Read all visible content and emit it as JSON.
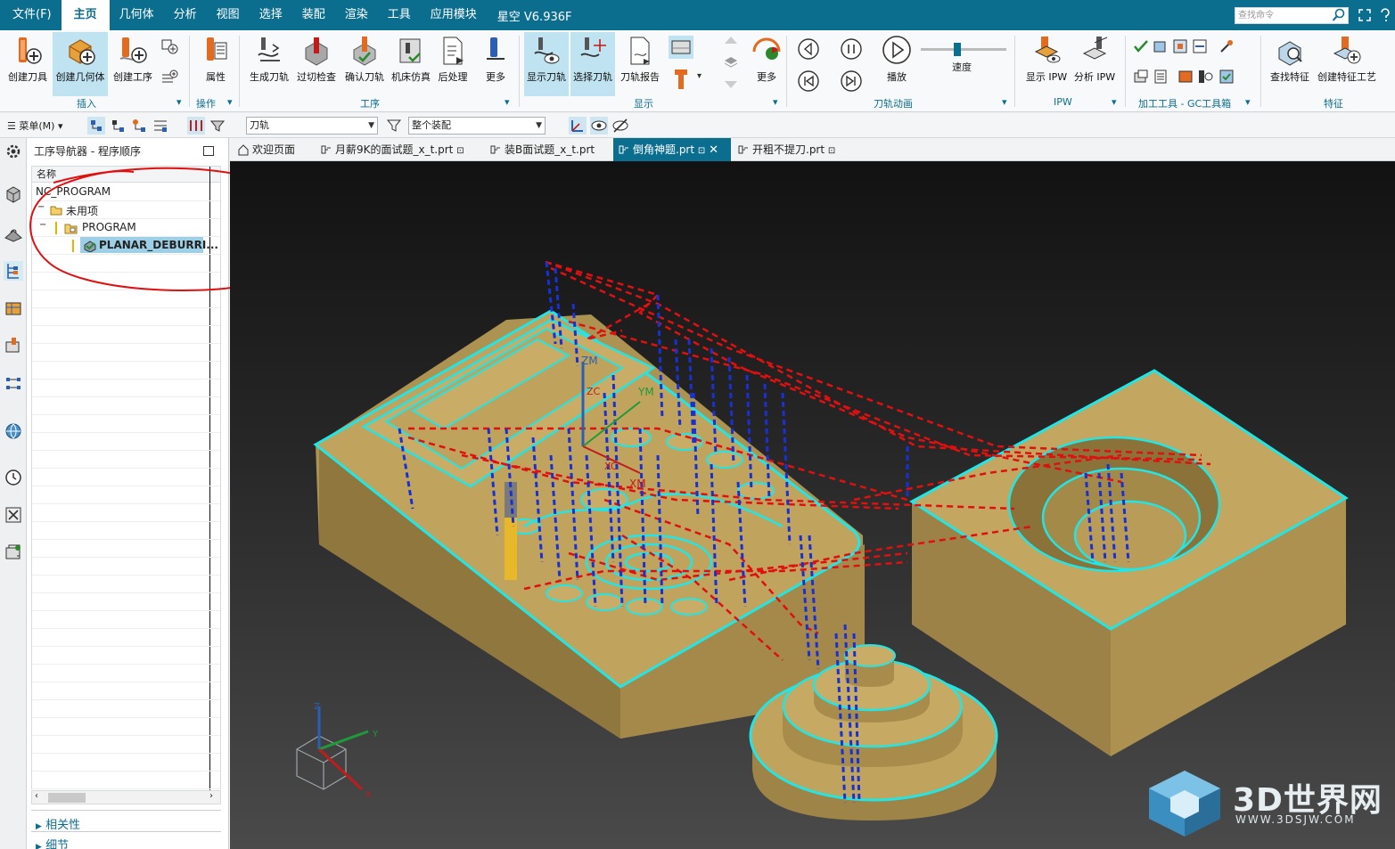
{
  "menu": {
    "items": [
      "文件(F)",
      "主页",
      "几何体",
      "分析",
      "视图",
      "选择",
      "装配",
      "渲染",
      "工具",
      "应用模块"
    ],
    "active": "主页",
    "version": "星空 V6.936F",
    "search_placeholder": "查找命令"
  },
  "ribbon": {
    "buttons": [
      "创建刀具",
      "创建几何体",
      "创建工序",
      "属性",
      "生成刀轨",
      "过切检查",
      "确认刀轨",
      "机床仿真",
      "后处理",
      "更多",
      "显示刀轨",
      "选择刀轨",
      "刀轨报告",
      "更多",
      "播放",
      "速度",
      "显示 IPW",
      "分析 IPW",
      "查找特征",
      "创建特征工艺"
    ],
    "groups": [
      "插入",
      "操作",
      "工序",
      "显示",
      "刀轨动画",
      "IPW",
      "加工工具 - GC工具箱",
      "特征"
    ]
  },
  "toolbar2": {
    "menu_label": "菜单(M)",
    "filter_value": "刀轨",
    "scope_value": "整个装配"
  },
  "navigator": {
    "title": "工序导航器 - 程序顺序",
    "column_header": "名称",
    "tree": [
      "NC_PROGRAM",
      "未用项",
      "PROGRAM",
      "PLANAR_DEBURRI..."
    ],
    "bottom_sections": [
      "相关性",
      "细节"
    ]
  },
  "tabs": [
    "欢迎页面",
    "月薪9K的面试题_x_t.prt",
    "装B面试题_x_t.prt",
    "倒角神题.prt",
    "开粗不提刀.prt"
  ],
  "active_tab": "倒角神题.prt",
  "viewport": {
    "axis_labels": [
      "ZM",
      "YM",
      "XM",
      "ZC",
      "XC"
    ],
    "triad": [
      "Z",
      "Y",
      "X"
    ]
  },
  "watermark": {
    "text": "3D世界网",
    "url": "WWW.3DSJW.COM"
  },
  "colors": {
    "brand": "#0c6e8f",
    "part": "#b59a55",
    "edge": "#22e5e5",
    "rapid": "#e01010",
    "plunge": "#1830d8"
  }
}
